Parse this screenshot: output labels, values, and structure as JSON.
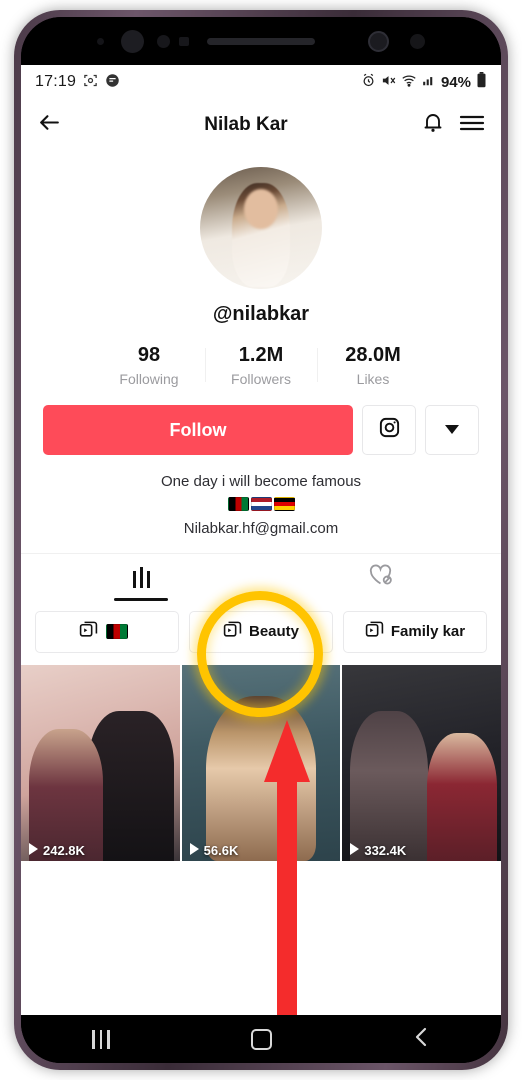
{
  "status_bar": {
    "time": "17:19",
    "icons_left": [
      "screenshot-icon",
      "app-icon"
    ],
    "icons_right": [
      "alarm-icon",
      "mute-icon",
      "wifi-icon",
      "signal-icon"
    ],
    "battery": "94%"
  },
  "header": {
    "back_icon": "back-arrow-icon",
    "title": "Nilab Kar",
    "bell_icon": "bell-icon",
    "menu_icon": "hamburger-menu-icon"
  },
  "profile": {
    "avatar_alt": "profile-avatar",
    "handle": "@nilabkar",
    "stats": [
      {
        "value": "98",
        "label": "Following"
      },
      {
        "value": "1.2M",
        "label": "Followers"
      },
      {
        "value": "28.0M",
        "label": "Likes"
      }
    ],
    "follow_label": "Follow",
    "follow_color": "#FE4B59",
    "instagram_icon": "instagram-icon",
    "dropdown_icon": "chevron-down-icon",
    "bio_line_1": "One day i will become famous",
    "bio_flags": [
      "flag-afghanistan",
      "flag-netherlands",
      "flag-germany"
    ],
    "bio_email": "Nilabkar.hf@gmail.com"
  },
  "tabs": [
    {
      "name": "videos",
      "icon": "grid-icon",
      "active": true
    },
    {
      "name": "liked",
      "icon": "heart-lock-icon",
      "active": false
    }
  ],
  "playlists": [
    {
      "label": "",
      "icon": "playlist-icon",
      "flag": "flag-afghanistan"
    },
    {
      "label": "Beauty",
      "icon": "playlist-icon"
    },
    {
      "label": "Family kar",
      "icon": "playlist-icon"
    }
  ],
  "videos": [
    {
      "views": "242.8K",
      "alt": "video-thumbnail-couple"
    },
    {
      "views": "56.6K",
      "alt": "video-thumbnail-portrait"
    },
    {
      "views": "332.4K",
      "alt": "video-thumbnail-couple-cafe"
    }
  ],
  "annotations": {
    "highlight_color": "#FFC400",
    "arrow_color": "#F42C2C"
  },
  "nav_bar": {
    "recents_label": "recents-button",
    "home_label": "home-button",
    "back_label": "back-button"
  }
}
